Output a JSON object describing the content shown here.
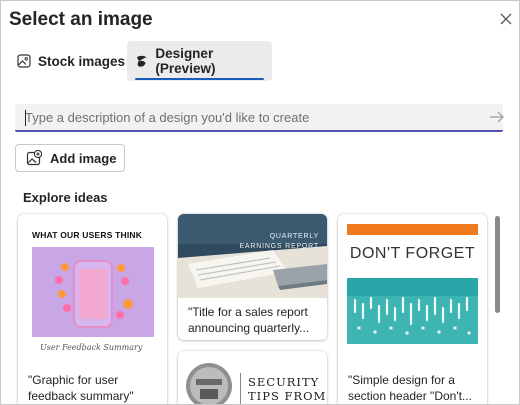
{
  "dialog": {
    "title": "Select an image",
    "close_icon": "close-icon"
  },
  "tabs": [
    {
      "label": "Stock images",
      "icon": "image-icon",
      "selected": false
    },
    {
      "label": "Designer (Preview)",
      "icon": "designer-icon",
      "selected": true
    }
  ],
  "search": {
    "placeholder": "Type a description of a design you'd like to create",
    "value": "",
    "submit_icon": "arrow-right-icon"
  },
  "add_image": {
    "label": "Add image",
    "icon": "image-add-icon"
  },
  "explore": {
    "heading": "Explore ideas",
    "cards": [
      {
        "image_heading": "WHAT OUR USERS THINK",
        "image_signature": "User Feedback Summary",
        "caption": "\"Graphic for user feedback summary\""
      },
      {
        "image_heading_lines": [
          "QUARTERLY",
          "EARNINGS REPORT"
        ],
        "caption": "\"Title for a sales report announcing quarterly..."
      },
      {
        "image_heading_lines": [
          "SECURITY",
          "TIPS FROM"
        ],
        "caption": ""
      },
      {
        "image_heading": "DON'T FORGET",
        "caption": "\"Simple design for a section header \"Don't..."
      }
    ]
  },
  "colors": {
    "accent": "#4f52b2",
    "tab_underline": "#1a5db6",
    "card1_bg": "#c9a6e6",
    "card4_orange": "#f07a1c",
    "card4_teal": "#3fb5b3"
  }
}
